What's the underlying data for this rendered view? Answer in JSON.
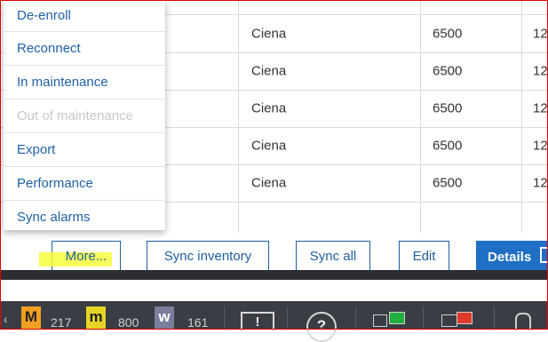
{
  "table": {
    "rows": [
      {
        "vendor": "",
        "model": "",
        "num": ""
      },
      {
        "vendor": "Ciena",
        "model": "6500",
        "num": "12"
      },
      {
        "vendor": "Ciena",
        "model": "6500",
        "num": "12"
      },
      {
        "vendor": "Ciena",
        "model": "6500",
        "num": "12"
      },
      {
        "vendor": "Ciena",
        "model": "6500",
        "num": "12"
      },
      {
        "vendor": "Ciena",
        "model": "6500",
        "num": "12"
      }
    ]
  },
  "menu": {
    "items": [
      {
        "label": "De-enroll",
        "enabled": true
      },
      {
        "label": "Reconnect",
        "enabled": true
      },
      {
        "label": "In maintenance",
        "enabled": true
      },
      {
        "label": "Out of maintenance",
        "enabled": false
      },
      {
        "label": "Export",
        "enabled": true
      },
      {
        "label": "Performance",
        "enabled": true
      },
      {
        "label": "Sync alarms",
        "enabled": true
      }
    ]
  },
  "buttons": {
    "more": "More...",
    "sync_inventory": "Sync inventory",
    "sync_all": "Sync all",
    "edit": "Edit",
    "details": "Details"
  },
  "taskbar": {
    "badge_m1": {
      "letter": "M",
      "count": "217",
      "color": "#f0a020"
    },
    "badge_m2": {
      "letter": "m",
      "count": "800",
      "color": "#e6d424"
    },
    "badge_w": {
      "letter": "w",
      "count": "161",
      "color": "#7a7d9c"
    },
    "warning_symbol": "!",
    "help_symbol": "?"
  },
  "colors": {
    "accent": "#1f5e9e",
    "primary_button": "#1f6fc4",
    "highlight": "#f5ff3d",
    "frame": "#e00000"
  }
}
